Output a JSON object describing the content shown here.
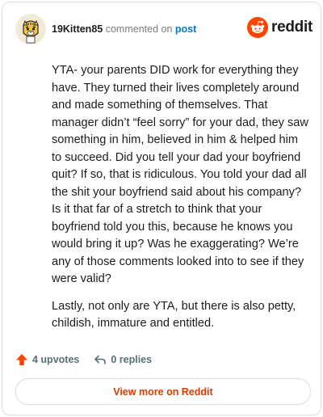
{
  "header": {
    "username": "19Kitten85",
    "commented_text": "commented on",
    "post_link": "post",
    "brand": "reddit"
  },
  "comment": {
    "paragraphs": [
      "YTA- your parents DID work for everything they have. They turned their lives completely around and made something of themselves. That manager didn’t “feel sorry” for your dad, they saw something in him, believed in him & helped him to succeed. Did you tell your dad your boyfriend quit? If so, that is ridiculous. You told your dad all the shit your boyfriend said about his company? Is it that far of a stretch to think that your boyfriend told you this, because he knows you would bring it up? Was he exaggerating? We’re any of those comments looked into to see if they were valid?",
      "Lastly, not only are YTA, but there is also petty, childish, immature and entitled."
    ]
  },
  "footer": {
    "upvotes": "4 upvotes",
    "replies": "0 replies",
    "view_more": "View more on Reddit"
  },
  "colors": {
    "accent": "#ff4500",
    "link": "#0079d3",
    "muted": "#576f76",
    "view_more": "#d93a00"
  },
  "icons": [
    "avatar-tiger",
    "reddit-logo-icon",
    "upvote-arrow-icon",
    "reply-arrow-icon"
  ]
}
